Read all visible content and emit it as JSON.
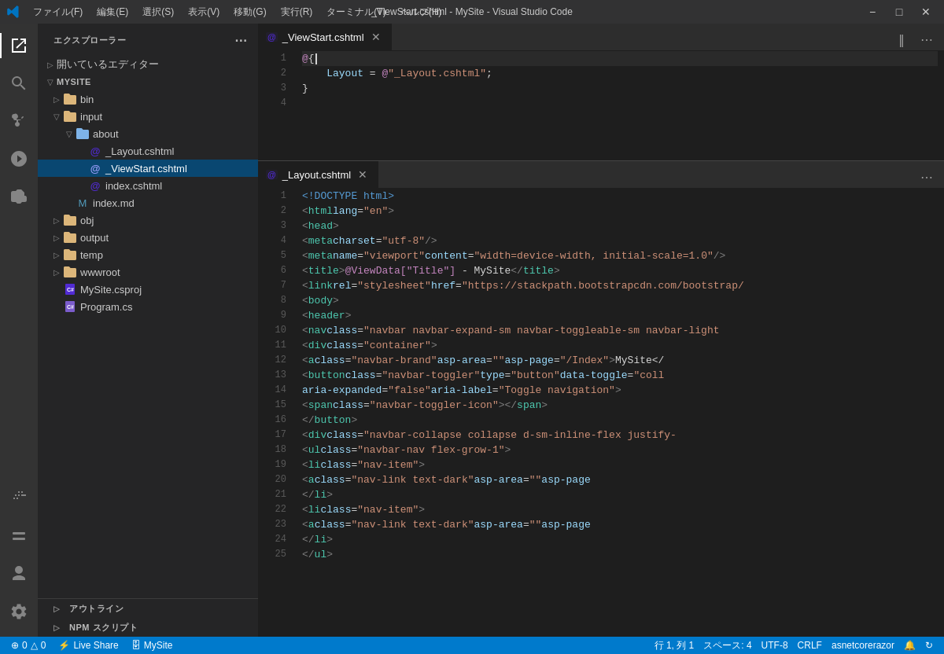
{
  "titleBar": {
    "title": "_ViewStart.cshtml - MySite - Visual Studio Code",
    "menu": [
      "ファイル(F)",
      "編集(E)",
      "選択(S)",
      "表示(V)",
      "移動(G)",
      "実行(R)",
      "ターミナル(T)",
      "ヘルプ(H)"
    ]
  },
  "sidebar": {
    "header": "エクスプローラー",
    "sections": {
      "openEditors": "開いているエディター",
      "mysite": "MYSITE"
    },
    "tree": [
      {
        "label": "bin",
        "type": "folder",
        "indent": 1
      },
      {
        "label": "input",
        "type": "folder",
        "indent": 1,
        "expanded": true
      },
      {
        "label": "about",
        "type": "folder",
        "indent": 2,
        "expanded": true
      },
      {
        "label": "_Layout.cshtml",
        "type": "cshtml",
        "indent": 3
      },
      {
        "label": "_ViewStart.cshtml",
        "type": "cshtml",
        "indent": 3,
        "active": true
      },
      {
        "label": "index.cshtml",
        "type": "cshtml",
        "indent": 3
      },
      {
        "label": "index.md",
        "type": "md",
        "indent": 2
      },
      {
        "label": "obj",
        "type": "folder",
        "indent": 1
      },
      {
        "label": "output",
        "type": "folder",
        "indent": 1
      },
      {
        "label": "temp",
        "type": "folder",
        "indent": 1
      },
      {
        "label": "wwwroot",
        "type": "folder",
        "indent": 1
      },
      {
        "label": "MySite.csproj",
        "type": "csproj",
        "indent": 1
      },
      {
        "label": "Program.cs",
        "type": "cs",
        "indent": 1
      }
    ],
    "bottomSections": [
      "アウトライン",
      "NPM スクリプト"
    ]
  },
  "topEditor": {
    "tab": "_ViewStart.cshtml",
    "lines": [
      {
        "num": 1,
        "content": "@{"
      },
      {
        "num": 2,
        "content": "    Layout = @\"_Layout.cshtml\";"
      },
      {
        "num": 3,
        "content": "}"
      },
      {
        "num": 4,
        "content": ""
      }
    ]
  },
  "bottomEditor": {
    "tab": "_Layout.cshtml",
    "lines": [
      {
        "num": 1,
        "html": "<span class='s-doctype'>&lt;!DOCTYPE html&gt;</span>"
      },
      {
        "num": 2,
        "html": "<span class='s-angle'>&lt;</span><span class='s-tag-name'>html</span> <span class='s-attr'>lang</span><span class='s-white'>=</span><span class='s-orange'>\"en\"</span><span class='s-angle'>&gt;</span>"
      },
      {
        "num": 3,
        "html": "    <span class='s-angle'>&lt;</span><span class='s-tag-name'>head</span><span class='s-angle'>&gt;</span>"
      },
      {
        "num": 4,
        "html": "        <span class='s-angle'>&lt;</span><span class='s-tag-name'>meta</span> <span class='s-attr'>charset</span><span class='s-white'>=</span><span class='s-orange'>\"utf-8\"</span> <span class='s-angle'>/&gt;</span>"
      },
      {
        "num": 5,
        "html": "        <span class='s-angle'>&lt;</span><span class='s-tag-name'>meta</span> <span class='s-attr'>name</span><span class='s-white'>=</span><span class='s-orange'>\"viewport\"</span> <span class='s-attr'>content</span><span class='s-white'>=</span><span class='s-orange'>\"width=device-width, initial-scale=1.0\"</span> <span class='s-angle'>/&gt;</span>"
      },
      {
        "num": 6,
        "html": "        <span class='s-angle'>&lt;</span><span class='s-tag-name'>title</span><span class='s-angle'>&gt;</span><span class='s-pink'>@ViewData[\"Title\"]</span><span class='s-white'> - MySite</span><span class='s-angle'>&lt;/</span><span class='s-tag-name'>title</span><span class='s-angle'>&gt;</span>"
      },
      {
        "num": 7,
        "html": "        <span class='s-angle'>&lt;</span><span class='s-tag-name'>link</span> <span class='s-attr'>rel</span><span class='s-white'>=</span><span class='s-orange'>\"stylesheet\"</span> <span class='s-attr'>href</span><span class='s-white'>=</span><span class='s-orange'>\"https://stackpath.bootstrapcdn.com/bootstrap/</span>"
      },
      {
        "num": 8,
        "html": "    <span class='s-angle'>&lt;</span><span class='s-tag-name'>body</span><span class='s-angle'>&gt;</span>"
      },
      {
        "num": 9,
        "html": "        <span class='s-angle'>&lt;</span><span class='s-tag-name'>header</span><span class='s-angle'>&gt;</span>"
      },
      {
        "num": 10,
        "html": "            <span class='s-angle'>&lt;</span><span class='s-tag-name'>nav</span> <span class='s-attr'>class</span><span class='s-white'>=</span><span class='s-orange'>\"navbar navbar-expand-sm navbar-toggleable-sm navbar-light</span>"
      },
      {
        "num": 11,
        "html": "                <span class='s-angle'>&lt;</span><span class='s-tag-name'>div</span> <span class='s-attr'>class</span><span class='s-white'>=</span><span class='s-orange'>\"container\"</span><span class='s-angle'>&gt;</span>"
      },
      {
        "num": 12,
        "html": "                    <span class='s-angle'>&lt;</span><span class='s-tag-name'>a</span> <span class='s-attr'>class</span><span class='s-white'>=</span><span class='s-orange'>\"navbar-brand\"</span> <span class='s-attr'>asp-area</span><span class='s-white'>=</span><span class='s-orange'>\"\"</span> <span class='s-attr'>asp-page</span><span class='s-white'>=</span><span class='s-orange'>\"/Index\"</span><span class='s-angle'>&gt;</span><span class='s-white'>MySite&lt;/</span>"
      },
      {
        "num": 13,
        "html": "                    <span class='s-angle'>&lt;</span><span class='s-tag-name'>button</span> <span class='s-attr'>class</span><span class='s-white'>=</span><span class='s-orange'>\"navbar-toggler\"</span> <span class='s-attr'>type</span><span class='s-white'>=</span><span class='s-orange'>\"button\"</span> <span class='s-attr'>data-toggle</span><span class='s-white'>=</span><span class='s-orange'>\"coll</span>"
      },
      {
        "num": 14,
        "html": "                            <span class='s-attr'>aria-expanded</span><span class='s-white'>=</span><span class='s-orange'>\"false\"</span> <span class='s-attr'>aria-label</span><span class='s-white'>=</span><span class='s-orange'>\"Toggle navigation\"</span><span class='s-angle'>&gt;</span>"
      },
      {
        "num": 15,
        "html": "                        <span class='s-angle'>&lt;</span><span class='s-tag-name'>span</span> <span class='s-attr'>class</span><span class='s-white'>=</span><span class='s-orange'>\"navbar-toggler-icon\"</span><span class='s-angle'>&gt;&lt;/</span><span class='s-tag-name'>span</span><span class='s-angle'>&gt;</span>"
      },
      {
        "num": 16,
        "html": "                    <span class='s-angle'>&lt;/</span><span class='s-tag-name'>button</span><span class='s-angle'>&gt;</span>"
      },
      {
        "num": 17,
        "html": "                    <span class='s-angle'>&lt;</span><span class='s-tag-name'>div</span> <span class='s-attr'>class</span><span class='s-white'>=</span><span class='s-orange'>\"navbar-collapse collapse d-sm-inline-flex justify-</span>"
      },
      {
        "num": 18,
        "html": "                        <span class='s-angle'>&lt;</span><span class='s-tag-name'>ul</span> <span class='s-attr'>class</span><span class='s-white'>=</span><span class='s-orange'>\"navbar-nav flex-grow-1\"</span><span class='s-angle'>&gt;</span>"
      },
      {
        "num": 19,
        "html": "                            <span class='s-angle'>&lt;</span><span class='s-tag-name'>li</span> <span class='s-attr'>class</span><span class='s-white'>=</span><span class='s-orange'>\"nav-item\"</span><span class='s-angle'>&gt;</span>"
      },
      {
        "num": 20,
        "html": "                                <span class='s-angle'>&lt;</span><span class='s-tag-name'>a</span> <span class='s-attr'>class</span><span class='s-white'>=</span><span class='s-orange'>\"nav-link text-dark\"</span> <span class='s-attr'>asp-area</span><span class='s-white'>=</span><span class='s-orange'>\"\"</span> <span class='s-attr'>asp-page</span>"
      },
      {
        "num": 21,
        "html": "                            <span class='s-angle'>&lt;/</span><span class='s-tag-name'>li</span><span class='s-angle'>&gt;</span>"
      },
      {
        "num": 22,
        "html": "                            <span class='s-angle'>&lt;</span><span class='s-tag-name'>li</span> <span class='s-attr'>class</span><span class='s-white'>=</span><span class='s-orange'>\"nav-item\"</span><span class='s-angle'>&gt;</span>"
      },
      {
        "num": 23,
        "html": "                                <span class='s-angle'>&lt;</span><span class='s-tag-name'>a</span> <span class='s-attr'>class</span><span class='s-white'>=</span><span class='s-orange'>\"nav-link text-dark\"</span> <span class='s-attr'>asp-area</span><span class='s-white'>=</span><span class='s-orange'>\"\"</span> <span class='s-attr'>asp-page</span>"
      },
      {
        "num": 24,
        "html": "                            <span class='s-angle'>&lt;/</span><span class='s-tag-name'>li</span><span class='s-angle'>&gt;</span>"
      },
      {
        "num": 25,
        "html": "                        <span class='s-angle'>&lt;/</span><span class='s-tag-name'>ul</span><span class='s-angle'>&gt;</span>"
      }
    ]
  },
  "statusBar": {
    "left": [
      {
        "icon": "⊕",
        "text": "0"
      },
      {
        "icon": "△",
        "text": "0"
      },
      {
        "text": "Live Share",
        "icon": "⚡"
      },
      {
        "icon": "⚡",
        "text": "MySite"
      }
    ],
    "right": [
      {
        "text": "行 1, 列 1"
      },
      {
        "text": "スペース: 4"
      },
      {
        "text": "UTF-8"
      },
      {
        "text": "CRLF"
      },
      {
        "text": "asnetcorerazor"
      }
    ]
  }
}
